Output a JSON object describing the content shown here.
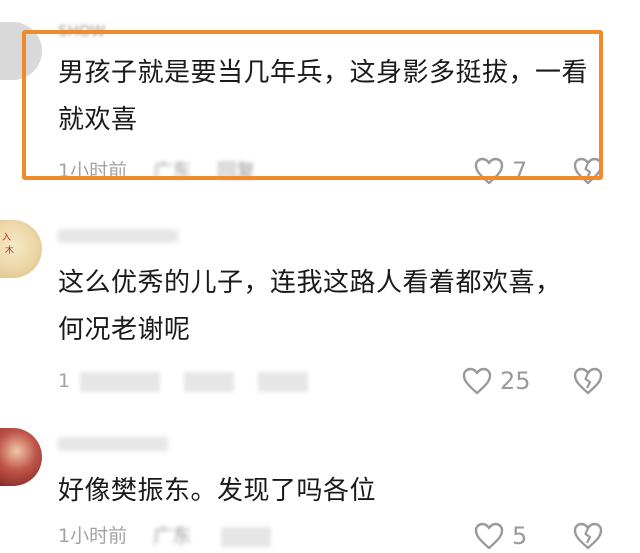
{
  "comments": [
    {
      "username": "SHOW",
      "text": "男孩子就是要当几年兵，这身影多挺拔，一看就欢喜",
      "time": "1小时前",
      "location": "广东",
      "reply_label": "回复",
      "likes": "7"
    },
    {
      "username": "",
      "text": "这么优秀的儿子，连我这路人看着都欢喜，何况老谢呢",
      "time": "1",
      "location": "",
      "reply_label": "",
      "likes": "25"
    },
    {
      "username": "",
      "text": "好像樊振东。发现了吗各位",
      "time": "1小时前",
      "location": "广东",
      "reply_label": "",
      "likes": "5"
    }
  ],
  "colors": {
    "highlight_border": "#f08a2a",
    "meta_text": "#999999"
  },
  "icons": {
    "like": "heart-outline-icon",
    "dislike": "broken-heart-icon"
  }
}
